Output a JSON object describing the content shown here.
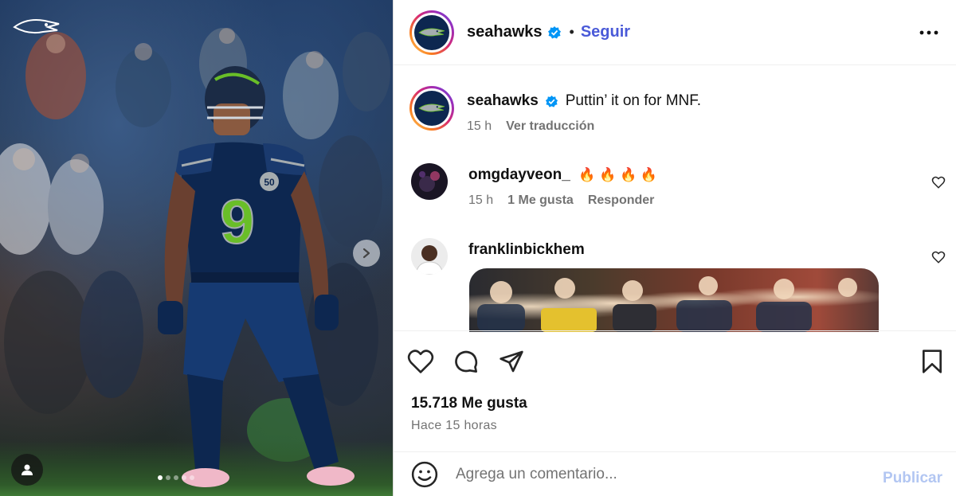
{
  "post": {
    "account": "seahawks",
    "follow_label": "Seguir",
    "separator": "•",
    "more_icon": "more-horizontal-icon",
    "brand_navy": "#0d2750",
    "brand_green": "#69be28",
    "link_blue": "#4a5ad8"
  },
  "caption": {
    "username": "seahawks",
    "text": "Puttin’ it on for MNF.",
    "time": "15 h",
    "translate_label": "Ver traducción"
  },
  "comments": [
    {
      "username": "omgdayveon_",
      "text": "🔥 🔥 🔥 🔥",
      "time": "15 h",
      "likes_label": "1 Me gusta",
      "reply_label": "Responder"
    },
    {
      "username": "franklinbickhem",
      "text": ""
    }
  ],
  "media": {
    "jersey_number": "9",
    "patch_number": "50",
    "carousel_count": 5,
    "carousel_active_index": 0
  },
  "stats": {
    "likes_label": "15.718 Me gusta",
    "time_ago": "Hace 15 horas"
  },
  "composer": {
    "placeholder": "Agrega un comentario...",
    "publish_label": "Publicar"
  }
}
